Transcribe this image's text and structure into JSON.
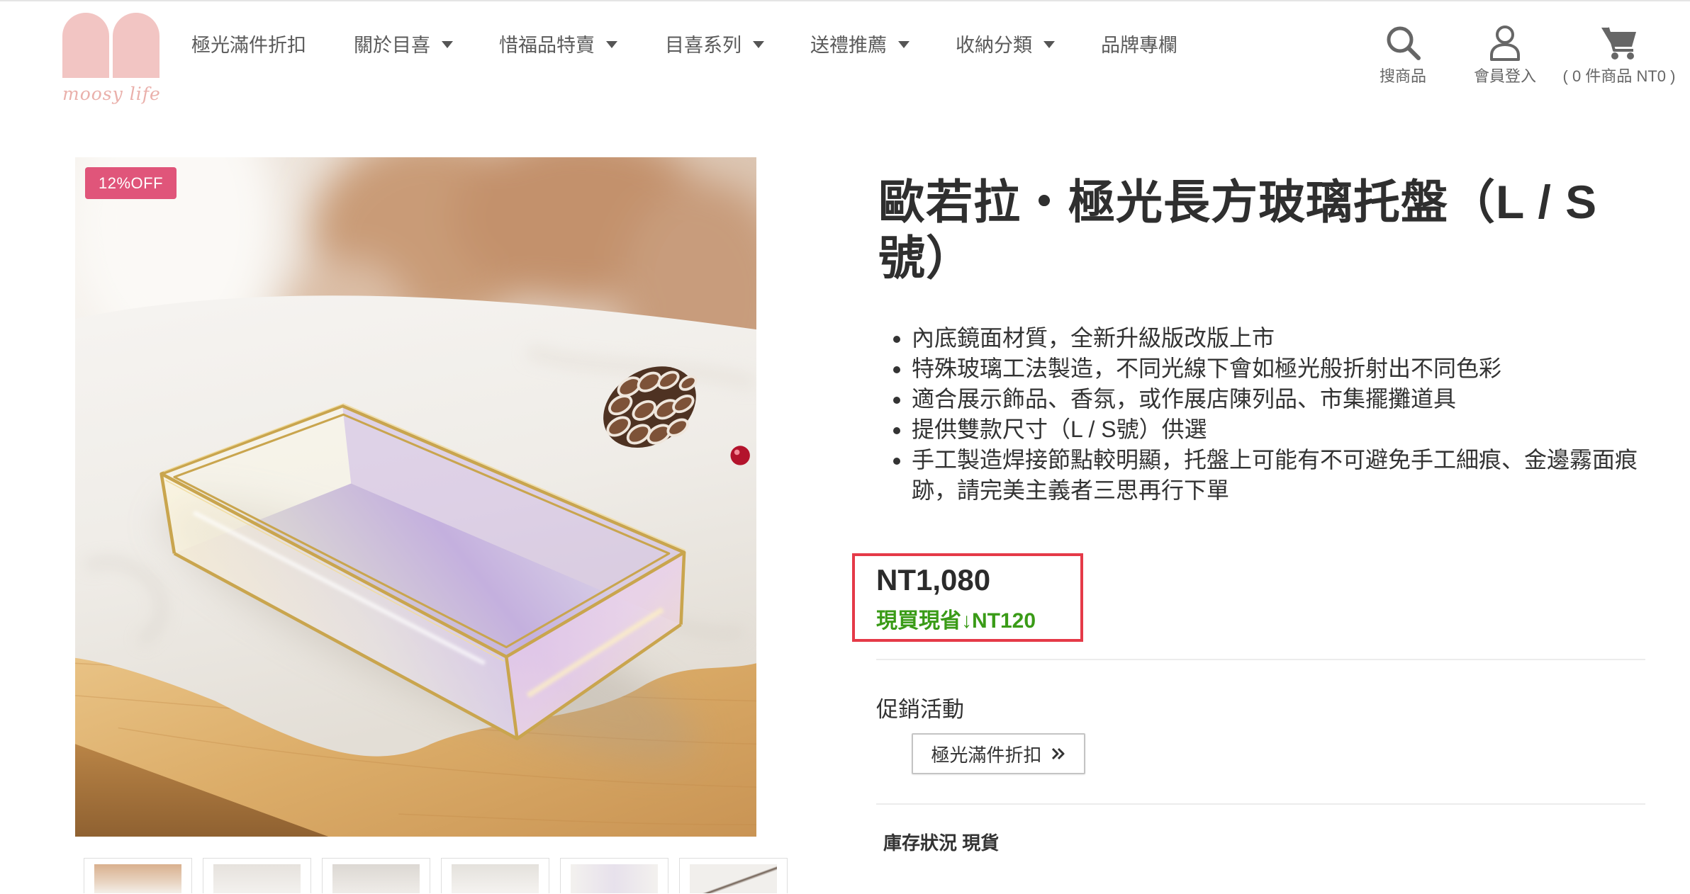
{
  "brand": {
    "logo_text": "moosy life"
  },
  "nav": [
    {
      "label": "極光滿件折扣",
      "dropdown": false
    },
    {
      "label": "關於目喜",
      "dropdown": true
    },
    {
      "label": "惜福品特賣",
      "dropdown": true
    },
    {
      "label": "目喜系列",
      "dropdown": true
    },
    {
      "label": "送禮推薦",
      "dropdown": true
    },
    {
      "label": "收納分類",
      "dropdown": true
    },
    {
      "label": "品牌專欄",
      "dropdown": false
    }
  ],
  "header_actions": [
    {
      "label": "搜商品",
      "icon": "search-icon"
    },
    {
      "label": "會員登入",
      "icon": "user-icon"
    },
    {
      "label": "( 0 件商品 NT0 )",
      "icon": "cart-icon"
    }
  ],
  "product": {
    "badge": "12%OFF",
    "title": "歐若拉・極光長方玻璃托盤（L / S 號）",
    "features": [
      "內底鏡面材質，全新升級版改版上市",
      "特殊玻璃工法製造，不同光線下會如極光般折射出不同色彩",
      "適合展示飾品、香氛，或作展店陳列品、市集擺攤道具",
      "提供雙款尺寸（L / S號）供選",
      "手工製造焊接節點較明顯，托盤上可能有不可避免手工細痕、金邊霧面痕跡，請完美主義者三思再行下單"
    ],
    "price": "NT1,080",
    "savings": "現買現省↓NT120",
    "promo_heading": "促銷活動",
    "promo_button": "極光滿件折扣",
    "stock_label": "庫存狀況",
    "stock_value": "現貨"
  },
  "colors": {
    "logo_pink": "#f2c5c3",
    "badge_pink": "#e0557a",
    "highlight_red": "#e53a48",
    "savings_green": "#3a9b17"
  }
}
